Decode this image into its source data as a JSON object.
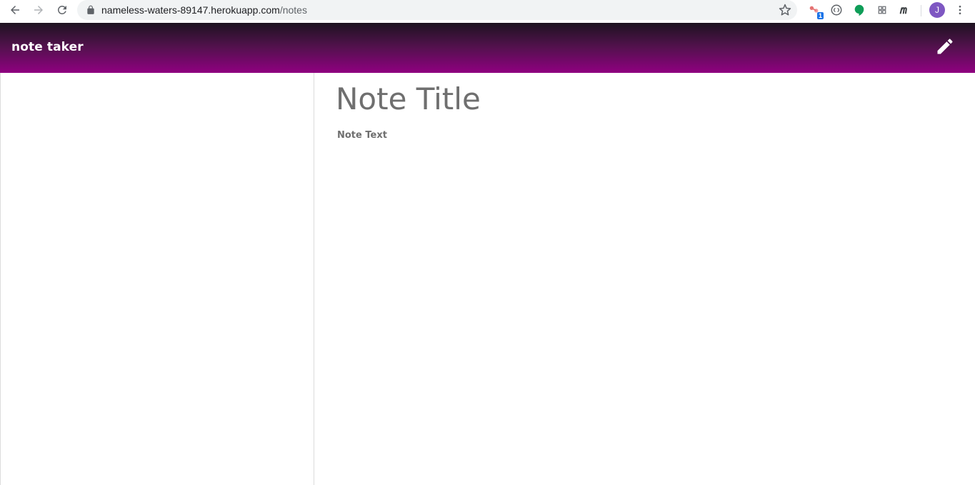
{
  "browser": {
    "url_host": "nameless-waters-89147.herokuapp.com",
    "url_path": "/notes",
    "extension_badge": "1",
    "profile_initial": "J"
  },
  "app": {
    "brand": "note taker"
  },
  "editor": {
    "title_placeholder": "Note Title",
    "text_placeholder": "Note Text"
  },
  "colors": {
    "header_top": "#1d1320",
    "header_bottom": "#8f0080",
    "placeholder_text": "#6f6f6f"
  }
}
